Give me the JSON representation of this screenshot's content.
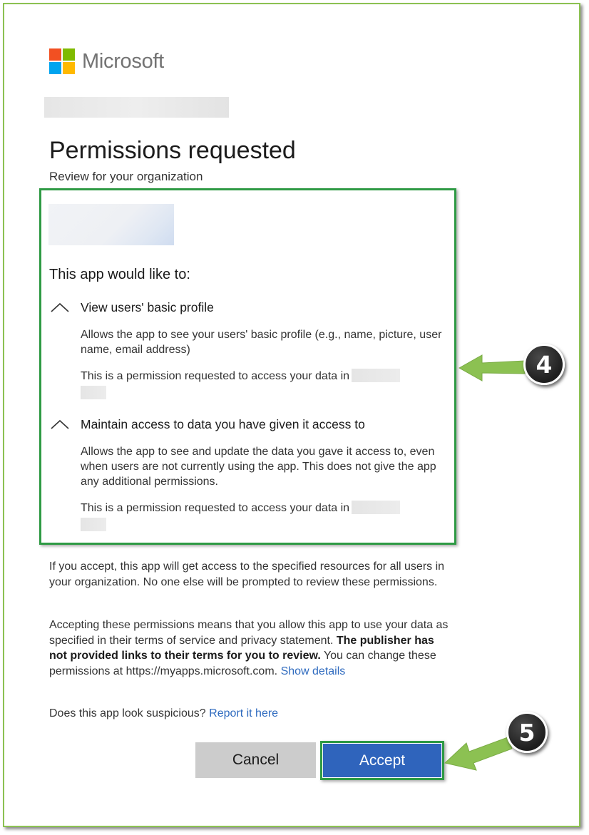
{
  "brand": {
    "name": "Microsoft",
    "logo_colors": [
      "#f25022",
      "#7fba00",
      "#00a4ef",
      "#ffb900"
    ]
  },
  "header": {
    "title": "Permissions requested",
    "subtitle": "Review for your organization"
  },
  "permissions_box": {
    "intro": "This app would like to:",
    "items": [
      {
        "title": "View users' basic profile",
        "description": "Allows the app to see your users' basic profile (e.g., name, picture, user name, email address)",
        "note": "This is a permission requested to access your data in",
        "expanded_icon": "chevron-up-icon"
      },
      {
        "title": "Maintain access to data you have given it access to",
        "description": "Allows the app to see and update the data you gave it access to, even when users are not currently using the app. This does not give the app any additional permissions.",
        "note": "This is a permission requested to access your data in",
        "expanded_icon": "chevron-up-icon"
      }
    ]
  },
  "consent": {
    "paragraph1": "If you accept, this app will get access to the specified resources for all users in your organization. No one else will be prompted to review these permissions.",
    "paragraph2_start": "Accepting these permissions means that you allow this app to use your data as specified in their terms of service and privacy statement.",
    "paragraph2_bold": "The publisher has not provided links to their terms for you to review.",
    "paragraph2_end": "You can change these permissions at https://myapps.microsoft.com.",
    "show_details_link": "Show details",
    "suspicious_text": "Does this app look suspicious?",
    "report_link": "Report it here"
  },
  "buttons": {
    "cancel": "Cancel",
    "accept": "Accept"
  },
  "annotations": {
    "step_4": "4",
    "step_5": "5",
    "highlight_color": "#2e9a44",
    "arrow_color": "#8cc152",
    "frame_color": "#8cc152"
  },
  "colors": {
    "accept_button": "#2f64bc",
    "cancel_button": "#cccccc",
    "link": "#2f6bbf"
  }
}
